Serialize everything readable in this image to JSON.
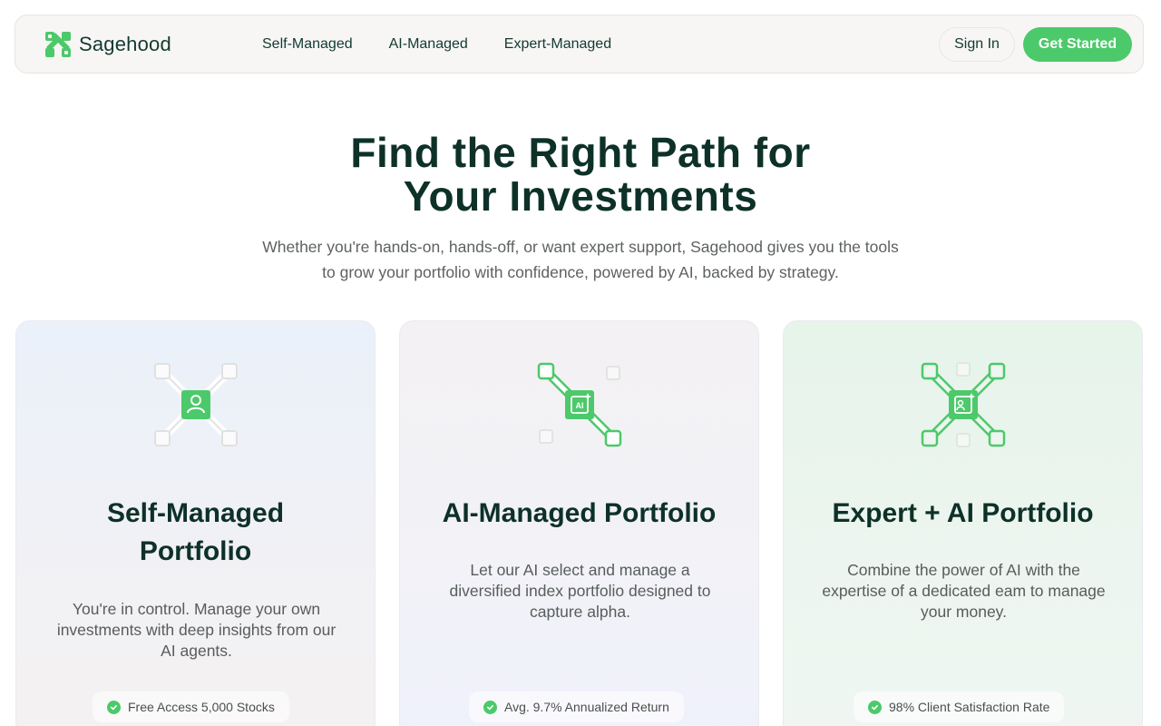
{
  "header": {
    "brand": "Sagehood",
    "nav": [
      "Self-Managed",
      "AI-Managed",
      "Expert-Managed"
    ],
    "sign_in": "Sign In",
    "get_started": "Get Started"
  },
  "hero": {
    "title_line1": "Find the Right Path for",
    "title_line2": "Your Investments",
    "subtitle_line1": "Whether you're hands-on, hands-off, or want expert support, Sagehood gives you the tools",
    "subtitle_line2": "to grow your portfolio with confidence, powered by AI, backed by strategy."
  },
  "cards": [
    {
      "title_line1": "Self-Managed",
      "title_line2": "Portfolio",
      "desc_lines": [
        "You're in control. Manage your own",
        "investments with deep insights from our",
        "AI agents."
      ],
      "badge": "Free Access 5,000 Stocks",
      "icon": "user-node-icon"
    },
    {
      "title_line1": "AI-Managed Portfolio",
      "desc_lines": [
        "Let our AI select and manage a",
        "diversified index portfolio designed to",
        "capture alpha."
      ],
      "badge": "Avg. 9.7% Annualized Return",
      "icon": "ai-node-icon"
    },
    {
      "title_line1": "Expert + AI Portfolio",
      "desc_lines": [
        "Combine the power of AI with the",
        "expertise of a dedicated eam to manage",
        "your money."
      ],
      "badge": "98% Client Satisfaction Rate",
      "icon": "expert-ai-node-icon"
    }
  ],
  "colors": {
    "accent": "#4cc96a",
    "text_dark": "#0d3128",
    "text_muted": "#5d625f"
  }
}
